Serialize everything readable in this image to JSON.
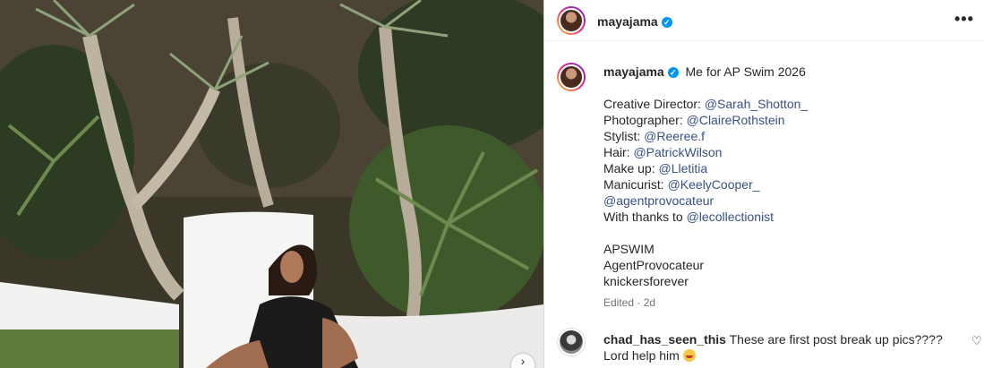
{
  "post": {
    "author": "mayajama",
    "more_icon": "more-horizontal-icon"
  },
  "caption": {
    "author": "mayajama",
    "headline": "Me for AP Swim 2026",
    "credits": [
      {
        "role": "Creative Director: ",
        "handle": "@Sarah_Shotton_"
      },
      {
        "role": "Photographer: ",
        "handle": "@ClaireRothstein"
      },
      {
        "role": "Stylist: ",
        "handle": "@Reeree.f"
      },
      {
        "role": "Hair: ",
        "handle": "@PatrickWilson"
      },
      {
        "role": "Make up: ",
        "handle": "@Lletitia"
      },
      {
        "role": "Manicurist: ",
        "handle": "@KeelyCooper_"
      },
      {
        "role": "",
        "handle": "@agentprovocateur"
      },
      {
        "role": "With thanks to ",
        "handle": "@lecollectionist"
      }
    ],
    "tags": [
      "APSWIM",
      "AgentProvocateur",
      "knickersforever"
    ],
    "meta": "Edited · 2d"
  },
  "comment": {
    "author": "chad_has_seen_this",
    "text": " These are first post break up pics???? Lord help him "
  },
  "colors": {
    "link": "#385185",
    "verified": "#0095f6"
  }
}
